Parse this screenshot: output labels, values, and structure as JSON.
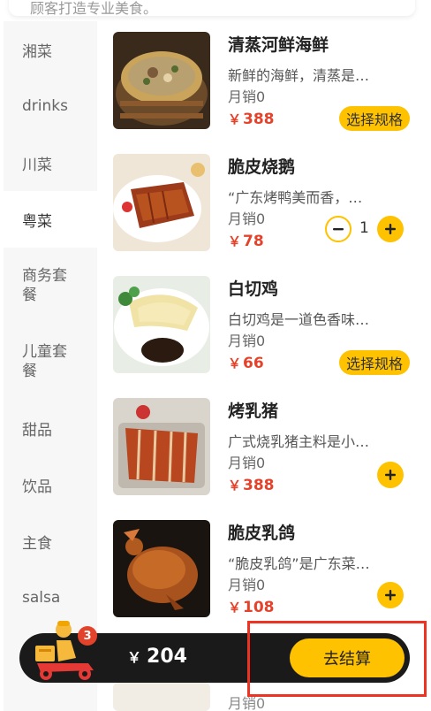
{
  "notice": {
    "text": "顾客打造专业美食。"
  },
  "sidebar": {
    "items": [
      {
        "label": "湘菜"
      },
      {
        "label": "drinks"
      },
      {
        "label": "川菜"
      },
      {
        "label": "粤菜"
      },
      {
        "label": "商务套餐"
      },
      {
        "label": "儿童套餐"
      },
      {
        "label": "甜品"
      },
      {
        "label": "饮品"
      },
      {
        "label": "主食"
      },
      {
        "label": "salsa"
      }
    ],
    "active": "粤菜"
  },
  "products": [
    {
      "name": "清蒸河鲜海鲜",
      "desc": "新鲜的海鲜，清蒸是…",
      "sales": "月销0",
      "currency": "￥",
      "price": "388",
      "action": "选择规格"
    },
    {
      "name": "脆皮烧鹅",
      "desc": "“广东烤鸭美而香，…",
      "sales": "月销0",
      "currency": "￥",
      "price": "78",
      "quantity": "1"
    },
    {
      "name": "白切鸡",
      "desc": "白切鸡是一道色香味…",
      "sales": "月销0",
      "currency": "￥",
      "price": "66",
      "action": "选择规格"
    },
    {
      "name": "烤乳猪",
      "desc": "广式烧乳猪主料是小…",
      "sales": "月销0",
      "currency": "￥",
      "price": "388"
    },
    {
      "name": "脆皮乳鸽",
      "desc": "“脆皮乳鸽”是广东菜…",
      "sales": "月销0",
      "currency": "￥",
      "price": "108"
    }
  ],
  "peek": {
    "sales": "月销0"
  },
  "cart": {
    "badge_count": "3",
    "currency": "￥",
    "total": "204",
    "checkout_label": "去结算"
  },
  "colors": {
    "accent": "#ffc200",
    "price": "#e4432b",
    "bar": "#1a1a1a",
    "highlight": "#ee3322"
  }
}
